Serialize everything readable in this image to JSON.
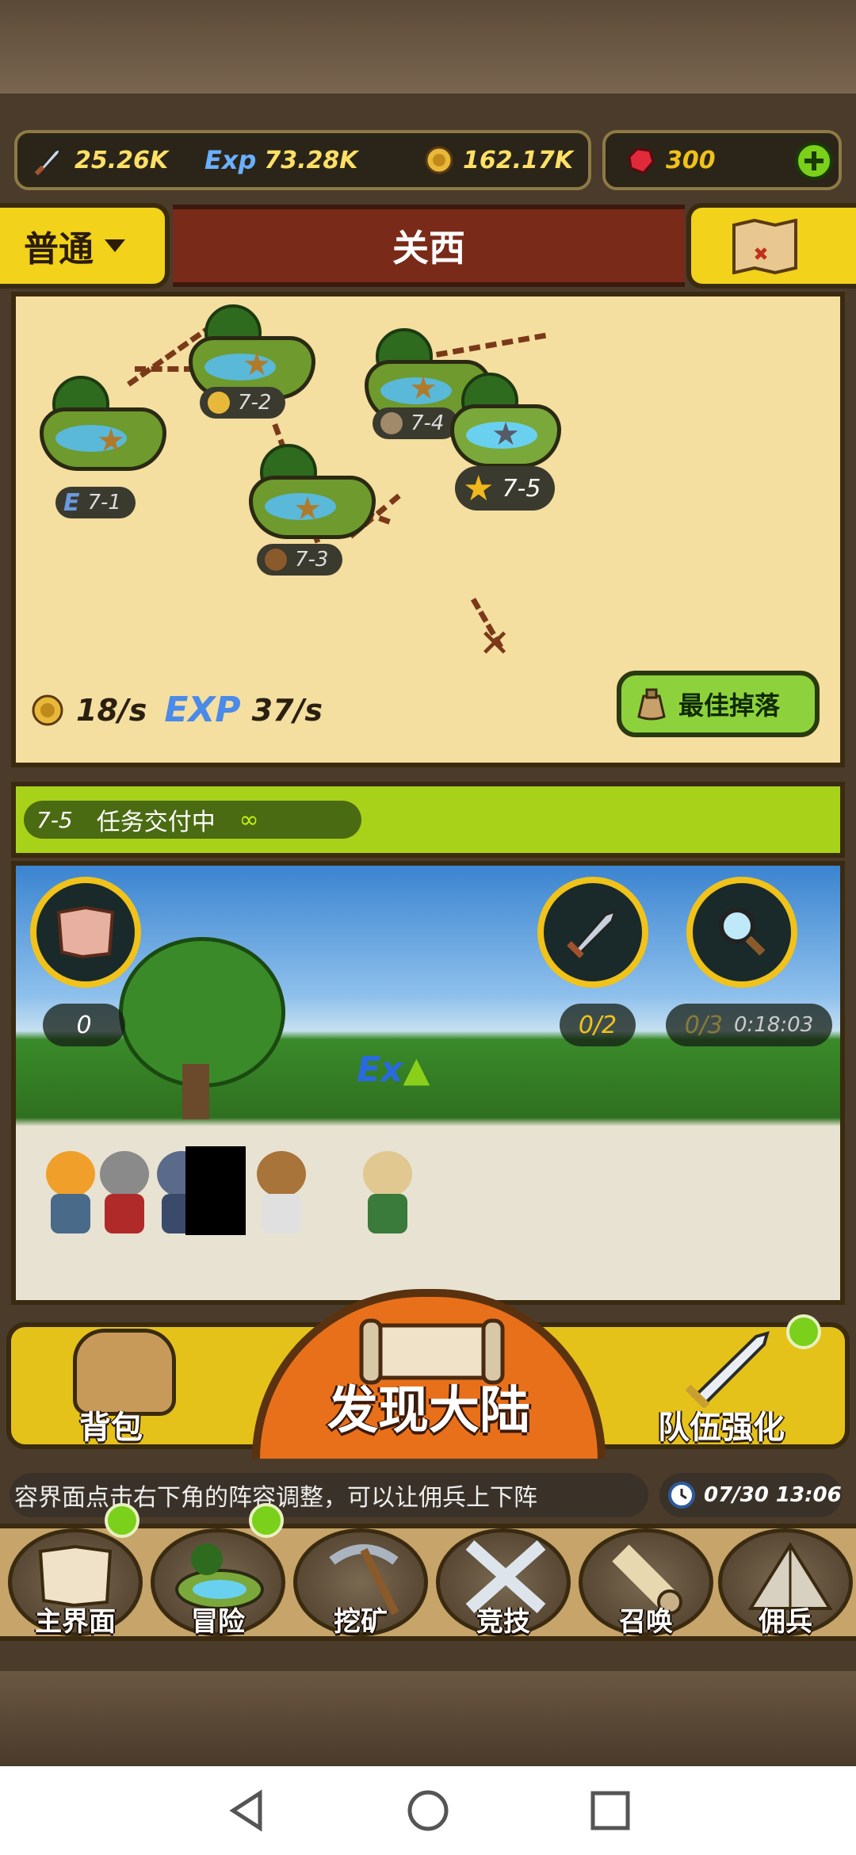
{
  "resources": {
    "attack": "25.26K",
    "exp": "73.28K",
    "gold": "162.17K",
    "gems": "300",
    "exp_icon_label": "Exp"
  },
  "header": {
    "mode": "普通",
    "region": "关西"
  },
  "map": {
    "stages": [
      {
        "id": "7-1",
        "badge": "E"
      },
      {
        "id": "7-2",
        "badge": ""
      },
      {
        "id": "7-3",
        "badge": ""
      },
      {
        "id": "7-4",
        "badge": ""
      },
      {
        "id": "7-5",
        "badge": ""
      }
    ],
    "gold_rate": "18/s",
    "exp_label": "EXP",
    "exp_rate": "37/s",
    "best_drop": "最佳掉落"
  },
  "quest": {
    "stage": "7-5",
    "status": "任务交付中",
    "symbol": "∞"
  },
  "battle": {
    "scroll_count": "0",
    "sword_count": "0/2",
    "search_count": "0/3",
    "search_timer": "0:18:03",
    "exp_popup": "Ex"
  },
  "actions": {
    "bag": "背包",
    "discover": "发现大陆",
    "team_upgrade": "队伍强化"
  },
  "ticker": {
    "message": "容界面点击右下角的阵容调整，可以让佣兵上下阵",
    "time": "07/30 13:06"
  },
  "nav": [
    {
      "label": "主界面"
    },
    {
      "label": "冒险"
    },
    {
      "label": "挖矿"
    },
    {
      "label": "竞技"
    },
    {
      "label": "召唤"
    },
    {
      "label": "佣兵"
    }
  ],
  "colors": {
    "gold": "#f0c21a",
    "quest_green": "#a8d21a",
    "title_red": "#7a2a18",
    "discover_orange": "#e8701a"
  }
}
